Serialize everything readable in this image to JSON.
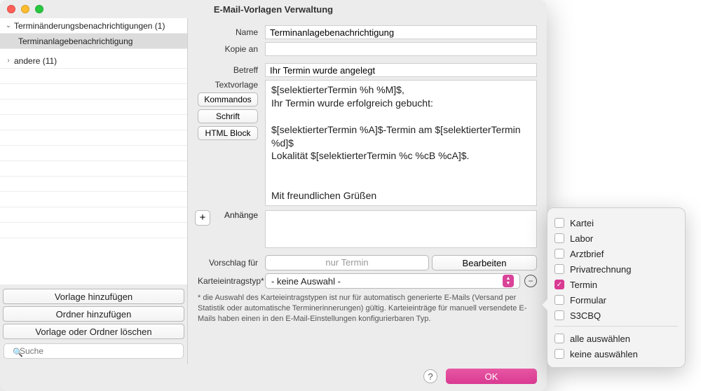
{
  "title": "E-Mail-Vorlagen Verwaltung",
  "tree": {
    "group1": {
      "label": "Terminänderungsbenachrichtigungen (1)",
      "expanded": true
    },
    "item_selected": "Terminanlagebenachrichtigung",
    "group2": {
      "label": "andere (11)",
      "expanded": false
    }
  },
  "sidebar_buttons": {
    "add_template": "Vorlage hinzufügen",
    "add_folder": "Ordner hinzufügen",
    "delete": "Vorlage oder Ordner löschen"
  },
  "search_placeholder": "Suche",
  "labels": {
    "name": "Name",
    "copy_to": "Kopie an",
    "subject": "Betreff",
    "template": "Textvorlage",
    "attachments": "Anhänge",
    "suggestion": "Vorschlag für",
    "entry_type": "Karteieintragstyp*"
  },
  "template_buttons": {
    "commands": "Kommandos",
    "font": "Schrift",
    "html_block": "HTML Block"
  },
  "fields": {
    "name": "Terminanlagebenachrichtigung",
    "copy_to": "",
    "subject": "Ihr Termin wurde angelegt",
    "template_text": "$[selektierterTermin %h %M]$,\nIhr Termin wurde erfolgreich gebucht:\n\n$[selektierterTermin %A]$-Termin am $[selektierterTermin %d]$\nLokalität $[selektierterTermin %c %cB %cA]$.\n\n\nMit freundlichen Grüßen\nIhr Praxisteam"
  },
  "suggestion_value": "nur Termin",
  "edit_button": "Bearbeiten",
  "combo_value": "- keine Auswahl -",
  "hint_text": "* die Auswahl des Karteieintragstypen ist nur für automatisch generierte E-Mails (Versand per Statistik oder automatische Terminerinnerungen) gültig. Karteieinträge für manuell versendete E-Mails haben einen in den E-Mail-Einstellungen konfigurierbaren Typ.",
  "ok_button": "OK",
  "popover": {
    "items": [
      "Kartei",
      "Labor",
      "Arztbrief",
      "Privatrechnung",
      "Termin",
      "Formular",
      "S3CBQ"
    ],
    "checked": "Termin",
    "select_all": "alle auswählen",
    "select_none": "keine auswählen"
  }
}
